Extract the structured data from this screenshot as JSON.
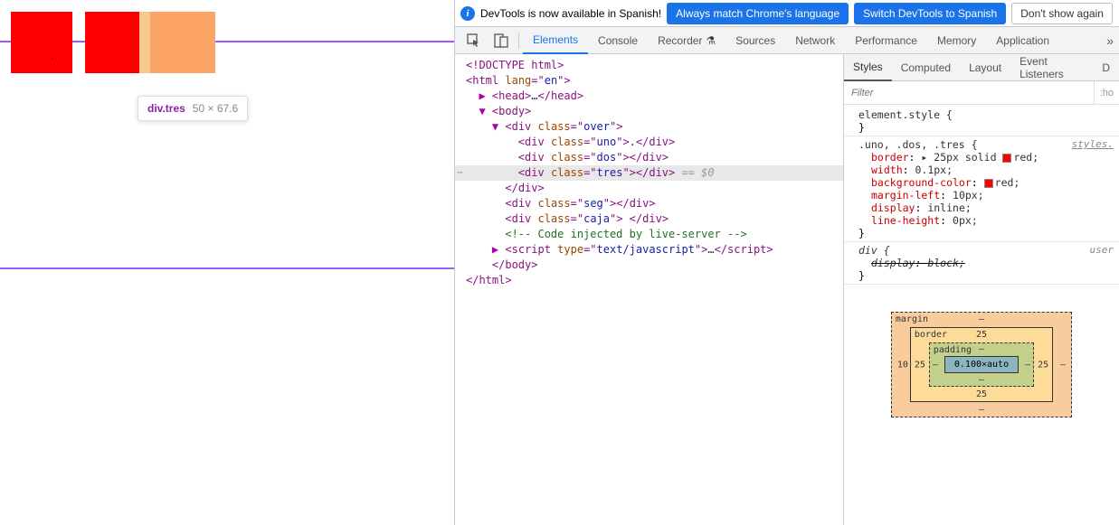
{
  "infobar": {
    "message": "DevTools is now available in Spanish!",
    "btn_match": "Always match Chrome's language",
    "btn_switch": "Switch DevTools to Spanish",
    "btn_dismiss": "Don't show again"
  },
  "tabs": {
    "elements": "Elements",
    "console": "Console",
    "recorder": "Recorder",
    "sources": "Sources",
    "network": "Network",
    "performance": "Performance",
    "memory": "Memory",
    "application": "Application"
  },
  "tooltip": {
    "selector": "div.tres",
    "dim": "50 × 67.6"
  },
  "dom": {
    "l1": "<!DOCTYPE html>",
    "l2_open": "<",
    "l2_tag": "html",
    "l2_attr": " lang",
    "l2_eq": "=\"",
    "l2_val": "en",
    "l2_close": "\">",
    "l3": "<head>…</head>",
    "l4": "<body>",
    "l5": "<div class=\"over\">",
    "l6": "<div class=\"uno\">.</div>",
    "l7": "<div class=\"dos\"></div>",
    "l8": "<div class=\"tres\"></div>",
    "l8_eq": " == $0",
    "l9": "</div>",
    "l10": "<div class=\"seg\"></div>",
    "l11_a": "<div class=\"caja\"> ",
    "l11_b": "</div>",
    "l12": "<!-- Code injected by live-server -->",
    "l13": "<script type=\"text/javascript\">…</scr",
    "l13b": "ipt>",
    "l14": "</body>",
    "l15": "</html>"
  },
  "subtabs": {
    "styles": "Styles",
    "computed": "Computed",
    "layout": "Layout",
    "listeners": "Event Listeners",
    "dom_more": "D"
  },
  "filter": {
    "placeholder": "Filter",
    "hov": ":ho"
  },
  "css": {
    "rule1_sel": "element.style {",
    "rule1_close": "}",
    "rule2_sel": ".uno, .dos, .tres {",
    "rule2_src": "styles.",
    "p_border_n": "border",
    "p_border_v": "25px solid ",
    "p_border_color": "red",
    "p_border_hex": "#ff0000",
    "p_width_n": "width",
    "p_width_v": "0.1px",
    "p_bg_n": "background-color",
    "p_bg_v": "red",
    "p_bg_hex": "#ff0000",
    "p_ml_n": "margin-left",
    "p_ml_v": "10px",
    "p_disp_n": "display",
    "p_disp_v": "inline",
    "p_lh_n": "line-height",
    "p_lh_v": "0px",
    "rule2_close": "}",
    "rule3_sel": "div {",
    "rule3_src": "user ",
    "p_disp2_n": "display",
    "p_disp2_v": "block",
    "rule3_close": "}"
  },
  "boxmodel": {
    "margin": "margin",
    "border": "border",
    "padding": "padding",
    "content": "0.100×auto",
    "m_top": "–",
    "m_left": "10",
    "m_right": "–",
    "m_bottom": "–",
    "b_top": "25",
    "b_left": "25",
    "b_right": "25",
    "b_bottom": "25",
    "p_top": "–",
    "p_left": "–",
    "p_right": "–",
    "p_bottom": "–"
  }
}
